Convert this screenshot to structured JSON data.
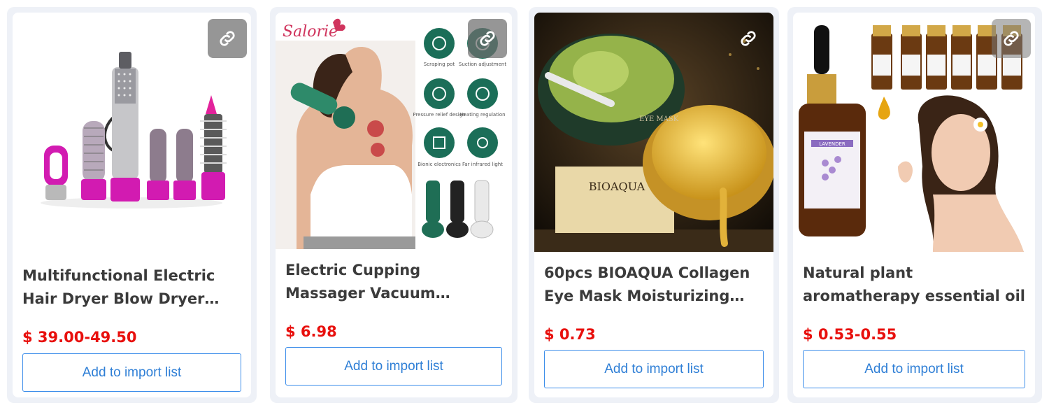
{
  "products": [
    {
      "title": "Multifunctional Electric Hair Dryer Blow Dryer Hair Straightener Curler Comb",
      "price": "$ 39.00-49.50",
      "button_label": "Add to import list",
      "link_icon": "link-icon",
      "image_icon": "hair-dryer-set-photo"
    },
    {
      "title": "Electric Cupping Massager Vacuum Suction Cup GuaSha Massager",
      "price": "$ 6.98",
      "button_label": "Add to import list",
      "link_icon": "link-icon",
      "image_icon": "cupping-massager-photo",
      "image_text": {
        "brand": "Salorie",
        "features": [
          "Scraping pot",
          "Suction adjustment",
          "Pressure relief design",
          "Heating regulation",
          "Bionic electronics",
          "Far infrared light"
        ]
      }
    },
    {
      "title": "60pcs BIOAQUA Collagen Eye Mask Moisturizing Firming Eye Patches",
      "price": "$ 0.73",
      "button_label": "Add to import list",
      "link_icon": "link-icon",
      "image_icon": "eye-mask-jar-photo",
      "image_text": {
        "brand": "BIOAQUA",
        "product": "EYE MASK"
      }
    },
    {
      "title": "Natural plant aromatherapy essential oil",
      "price": "$ 0.53-0.55",
      "button_label": "Add to import list",
      "link_icon": "link-icon",
      "image_icon": "essential-oil-photo",
      "image_text": {
        "label": "LAVENDER"
      }
    }
  ],
  "colors": {
    "price": "#e8100d",
    "button_border": "#3d8eea",
    "card_bg": "#eef1f7"
  }
}
